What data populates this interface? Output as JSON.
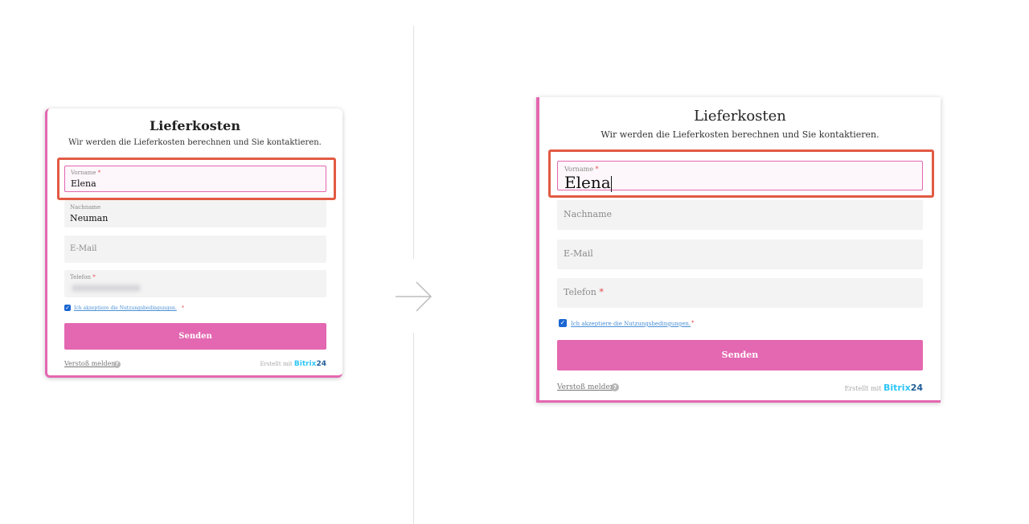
{
  "form": {
    "title": "Lieferkosten",
    "subtitle": "Wir werden die Lieferkosten berechnen und Sie kontaktieren.",
    "fields": {
      "first_name": {
        "label": "Vorname",
        "required_mark": "*",
        "value": "Elena"
      },
      "last_name": {
        "label": "Nachname",
        "value": "Neuman"
      },
      "email": {
        "label": "E-Mail"
      },
      "phone": {
        "label": "Telefon",
        "required_mark": "*"
      }
    },
    "consent": {
      "label": "Ich akzeptiere die Nutzungsbedingungen.",
      "required_mark": "*",
      "checked": true
    },
    "submit_label": "Senden",
    "report_label": "Verstoß melden",
    "report_icon": "question-circle-icon",
    "branding": {
      "prefix": "Erstellt mit",
      "brand": "Bitrix",
      "brand_suffix": "24"
    }
  },
  "transition_icon": "arrow-right-icon",
  "colors": {
    "accent": "#e467b1",
    "highlight": "#e25a43",
    "link": "#4a90d6",
    "required": "#e5484d",
    "field_bg": "#f3f3f3"
  }
}
